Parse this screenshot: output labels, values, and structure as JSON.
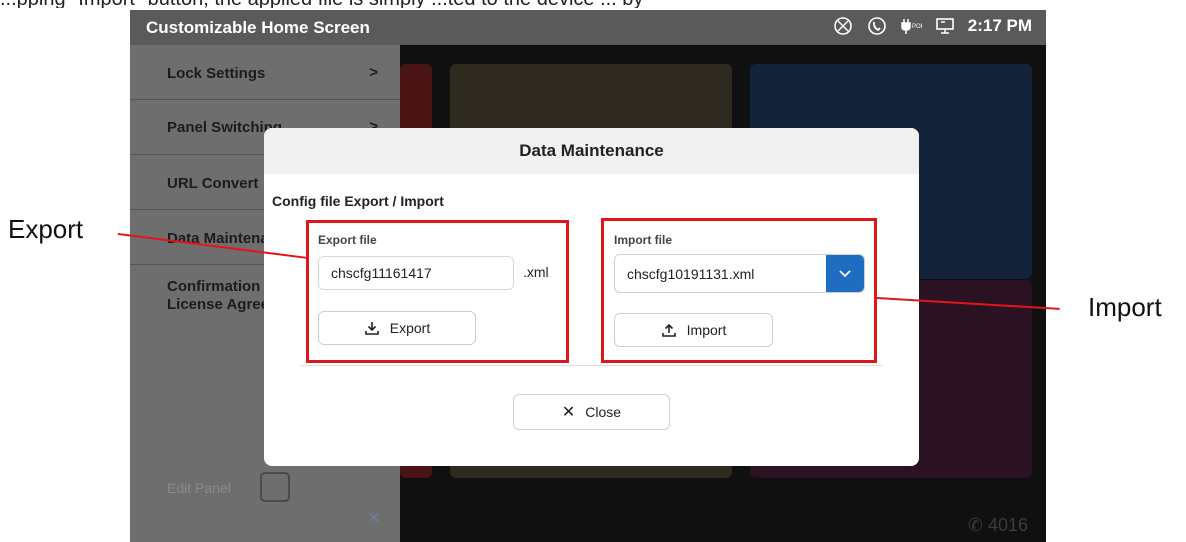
{
  "caption": "...pping \"Import\" button, the applied file is simply ...ted to the device ... by",
  "app": {
    "title": "Customizable Home Screen",
    "time": "2:17 PM",
    "extension": "4016"
  },
  "status_icons": [
    "no-network-icon",
    "phone-icon",
    "poe-plug-icon",
    "desktop-icon"
  ],
  "sidebar": {
    "items": [
      {
        "label": "Lock Settings",
        "chevron": ">"
      },
      {
        "label": "Panel Switching",
        "chevron": ">"
      },
      {
        "label": "URL Convert",
        "chevron": ""
      },
      {
        "label": "Data Maintenance",
        "chevron": ""
      },
      {
        "label": "Confirmation",
        "label2": "License Agree",
        "chevron": ""
      }
    ],
    "edit_panel": "Edit Panel"
  },
  "dialog": {
    "title": "Data Maintenance",
    "section_title": "Config file Export / Import",
    "export": {
      "label": "Export file",
      "value": "chscfg11161417",
      "suffix": ".xml",
      "button": "Export"
    },
    "import": {
      "label": "Import file",
      "selected": "chscfg10191131.xml",
      "button": "Import"
    },
    "close_button": "Close"
  },
  "callouts": {
    "export": "Export",
    "import": "Import"
  },
  "colors": {
    "highlight": "#e0161b",
    "accent": "#1e6dc1",
    "statusbar": "#5a5a5a",
    "sidebar": "#6e6e6e"
  }
}
